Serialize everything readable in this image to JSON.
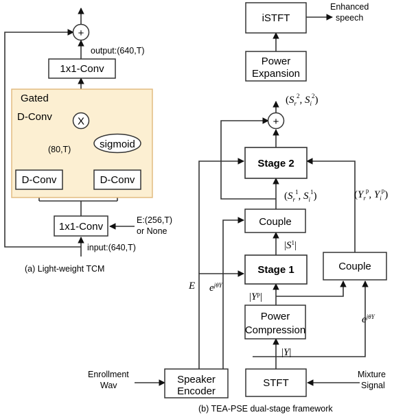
{
  "figure": {
    "panel_a": {
      "caption": "(a) Light-weight TCM",
      "region_label_line1": "Gated",
      "region_label_line2": "D-Conv",
      "region_color": "#fcefd2",
      "region_border_color": "#e0b87a",
      "boxes": {
        "conv_top": "1x1-Conv",
        "conv_bottom": "1x1-Conv",
        "dconv_left": "D-Conv",
        "dconv_right": "D-Conv",
        "sigmoid": "sigmoid"
      },
      "ops": {
        "add": "+",
        "multiply": "X"
      },
      "annotations": {
        "output": "output:(640,T)",
        "mid_shape": "(80,T)",
        "input": "input:(640,T)",
        "embedding_line1": "E:(256,T)",
        "embedding_line2": "or None"
      }
    },
    "panel_b": {
      "caption": "(b) TEA-PSE  dual-stage  framework",
      "boxes": {
        "istft": "iSTFT",
        "power_expansion_line1": "Power",
        "power_expansion_line2": "Expansion",
        "stage2": "Stage 2",
        "couple_left": "Couple",
        "stage1": "Stage 1",
        "couple_right": "Couple",
        "power_compression_line1": "Power",
        "power_compression_line2": "Compression",
        "stft": "STFT",
        "speaker_encoder_line1": "Speaker",
        "speaker_encoder_line2": "Encoder"
      },
      "ops": {
        "add": "+"
      },
      "io_labels": {
        "enhanced_speech_line1": "Enhanced",
        "enhanced_speech_line2": "speech",
        "mixture_signal_line1": "Mixture",
        "mixture_signal_line2": "Signal",
        "enrollment_wav_line1": "Enrollment",
        "enrollment_wav_line2": "Wav"
      },
      "signal_labels": {
        "stage2_out": "(S_r^2, S_i^2)",
        "stage1_out": "(S_r^1, S_i^1)",
        "coupled_mag": "|S^1|",
        "compressed_mag": "|Y^p|",
        "raw_mag": "|Y|",
        "couple_right_out": "(Y_r^p, Y_i^p)",
        "embedding": "E",
        "phase_left": "e^{jθ_Y}",
        "phase_right": "e^{jθ_Y}"
      }
    }
  }
}
